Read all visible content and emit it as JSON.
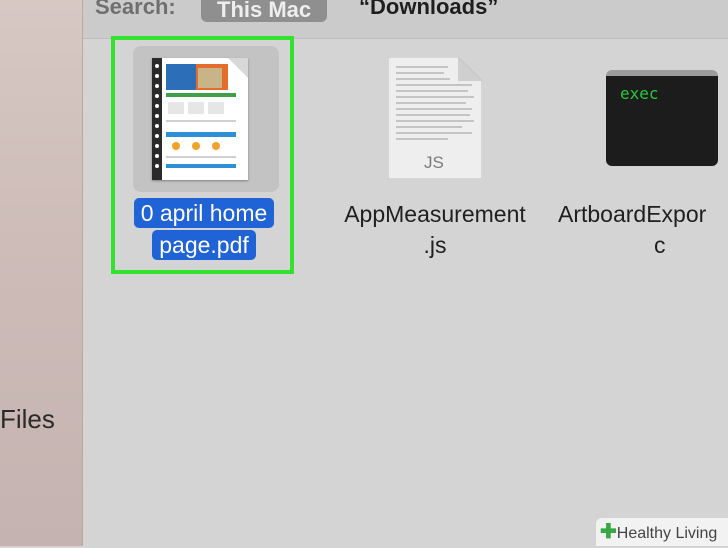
{
  "sidebar": {
    "files_label": "Files"
  },
  "search": {
    "label": "Search:",
    "scope_1": "This Mac",
    "scope_2": "“Downloads”"
  },
  "files": [
    {
      "name_line1": "0 april home",
      "name_line2": "page.pdf",
      "selected": true
    },
    {
      "name_line1": "AppMeasurement",
      "name_line2": ".js",
      "icon_text": "JS"
    },
    {
      "name_line1": "ArtboardExpor",
      "name_line2": "c",
      "icon_text": "exec"
    }
  ],
  "watermark": {
    "text": "Healthy Living"
  },
  "colors": {
    "selection": "#1f63d6",
    "highlight": "#33e22d",
    "terminal_text": "#28c83a"
  }
}
